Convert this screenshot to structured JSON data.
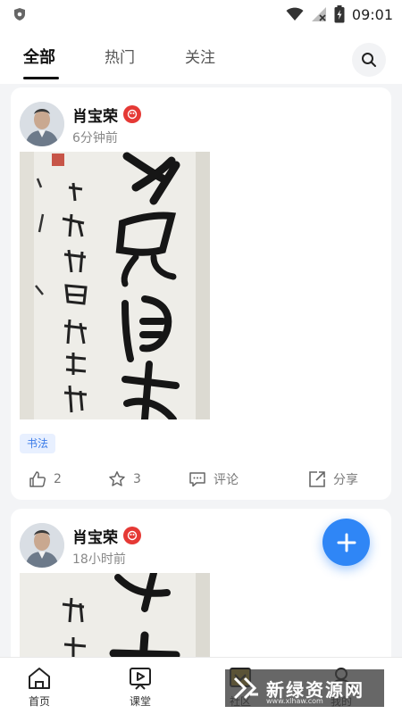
{
  "status_bar": {
    "time": "09:01"
  },
  "tabs": [
    {
      "label": "全部"
    },
    {
      "label": "热门"
    },
    {
      "label": "关注"
    }
  ],
  "posts": [
    {
      "author": "肖宝荣",
      "time": "6分钟前",
      "tag": "书法",
      "likes": "2",
      "favorites": "3",
      "comment_label": "评论",
      "share_label": "分享"
    },
    {
      "author": "肖宝荣",
      "time": "18小时前"
    }
  ],
  "bottom_nav": [
    {
      "label": "首页"
    },
    {
      "label": "课堂"
    },
    {
      "label": "社区"
    },
    {
      "label": "我的"
    }
  ],
  "watermark": {
    "title": "新绿资源网",
    "sub": "www.xlhaw.com"
  },
  "colors": {
    "accent": "#2f86f6",
    "badge": "#e53935",
    "tag_text": "#3a7be8"
  }
}
